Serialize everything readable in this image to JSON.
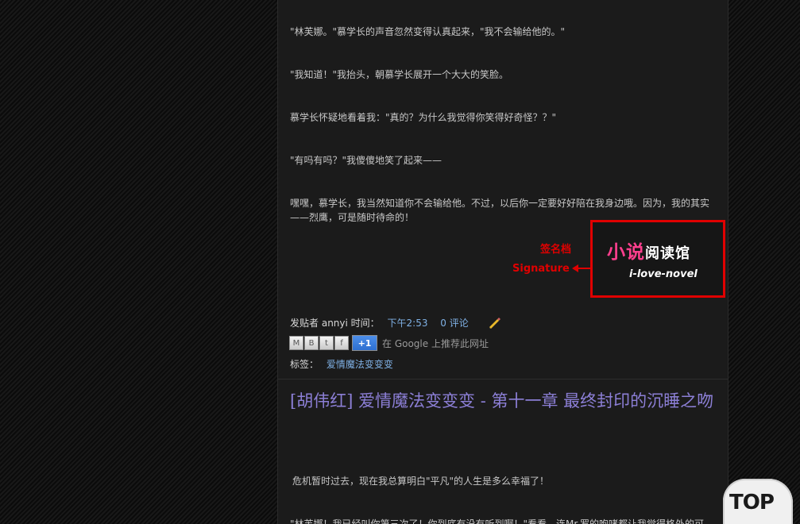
{
  "paragraphs_top": [
    "\"林芙娜。\"慕学长的声音忽然变得认真起来，\"我不会输给他的。\"",
    "\"我知道！\"我抬头，朝慕学长展开一个大大的笑脸。",
    "慕学长怀疑地看着我：\"真的？为什么我觉得你笑得好奇怪？？\"",
    "\"有吗有吗？\"我傻傻地笑了起来——",
    "嘿嘿，慕学长，我当然知道你不会输给他。不过，以后你一定要好好陪在我身边哦。因为，我的其实——烈鹰，可是随时待命的！"
  ],
  "signature": {
    "label_cn": "签名档",
    "label_en": "Signature",
    "logo_cn_part1": "小说",
    "logo_cn_part2": "阅读馆",
    "logo_en": "i-love-novel"
  },
  "post_footer": {
    "posted_by_label": "发贴者",
    "author": "annyi",
    "time_label": "时间：",
    "time": "下午2:53",
    "comments": "0 评论",
    "share_buttons": [
      "M",
      "B",
      "t",
      "f"
    ],
    "plus_one": "+1",
    "share_text": "在 Google 上推荐此网址",
    "tags_label": "标签：",
    "tag": "爱情魔法变变变"
  },
  "next_post": {
    "title": "[胡伟红] 爱情魔法变变变 - 第十一章 最终封印的沉睡之吻",
    "paragraph_1": "危机暂时过去，现在我总算明白\"平凡\"的人生是多么幸福了！",
    "paragraph_2_partial": "\"林芙娜！我已经叫你第三次了！你到底有没有听到啊！\"看看，连Mr.罗的咆哮都让我觉得格外的可"
  },
  "top_button": "TOP"
}
